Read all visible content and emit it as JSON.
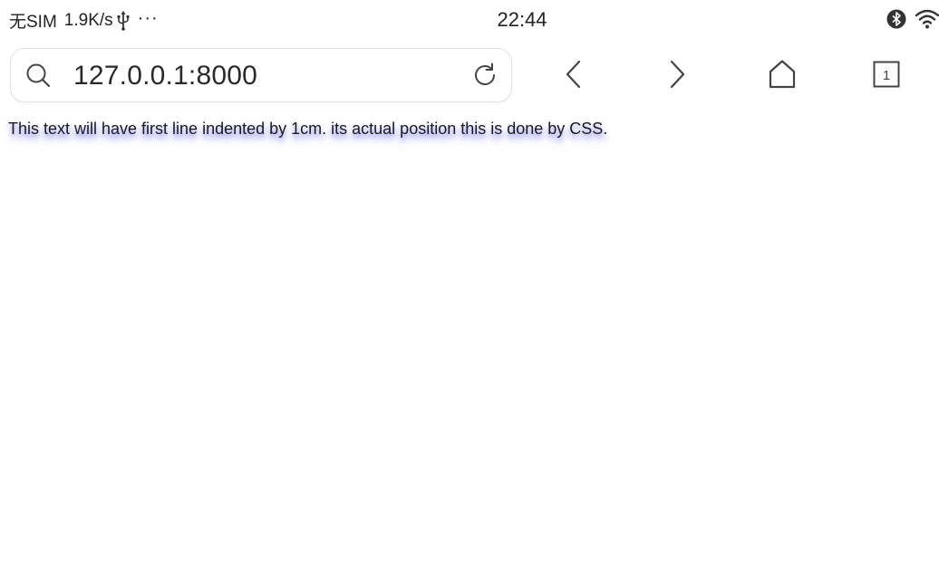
{
  "status_bar": {
    "carrier": "无SIM",
    "net_speed": "1.9K/s",
    "more_dots": "···",
    "time": "22:44",
    "icons": {
      "usb": "usb-icon",
      "bluetooth": "bluetooth-icon",
      "wifi": "wifi-icon"
    }
  },
  "browser": {
    "address": {
      "url": "127.0.0.1:8000"
    },
    "icons": {
      "search": "search-icon",
      "reload": "reload-icon",
      "back": "chevron-left-icon",
      "forward": "chevron-right-icon",
      "home": "home-icon",
      "tabs": "tabs-icon"
    },
    "tab_count": "1"
  },
  "page": {
    "text": "This text will have first line indented by 1cm. its actual position this is done by CSS."
  },
  "colors": {
    "text": "#1a1a1a",
    "icon": "#444444",
    "text_glow": "#4646f0",
    "address_border": "#e2e2e2",
    "background": "#ffffff"
  }
}
